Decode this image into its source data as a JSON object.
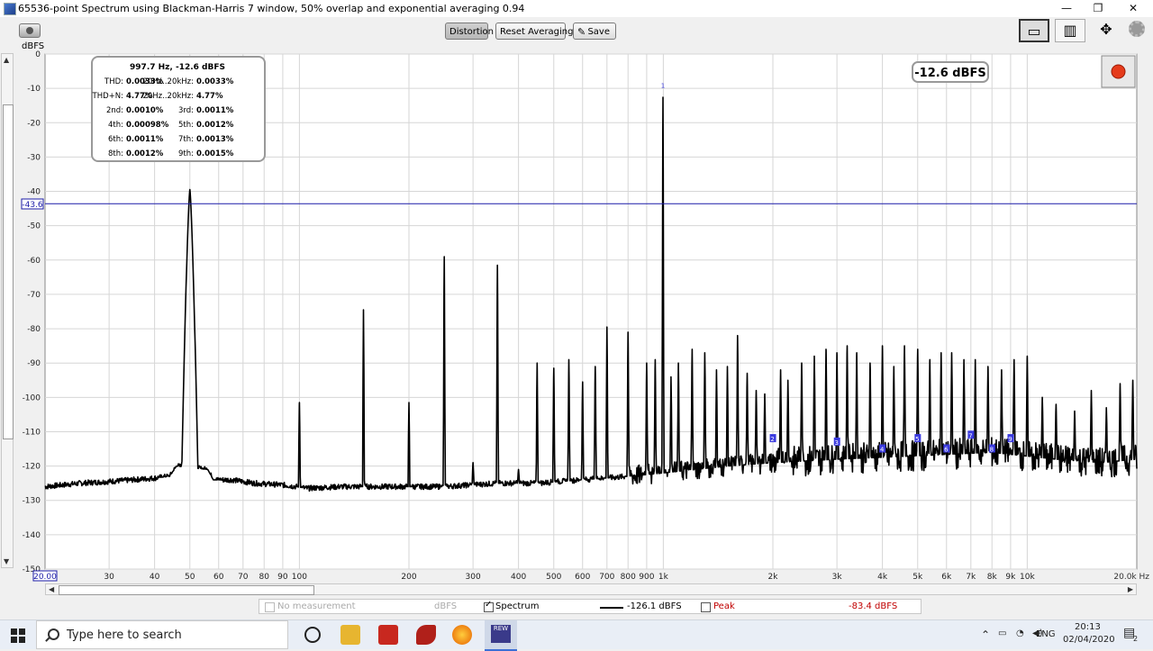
{
  "window": {
    "title": "65536-point Spectrum using Blackman-Harris 7 window, 50% overlap and exponential averaging 0.94",
    "minimize": "—",
    "restore": "❐",
    "close": "✕"
  },
  "toolbar": {
    "distortion_label": "Distortion",
    "reset_label": "Reset Averaging",
    "save_label": "Save",
    "unit_label": "dBFS",
    "icons": [
      "camera-icon",
      "pen-icon",
      "window-view-icon",
      "split-view-icon",
      "move-arrows-icon",
      "gear-icon"
    ]
  },
  "level_badge": "-12.6 dBFS",
  "cursor_level": "-43.6",
  "x_start_label": "20.00",
  "x_end_label": "20.0k Hz",
  "distortion_table": {
    "header": "997.7 Hz, -12.6 dBFS",
    "rows": [
      {
        "l1": "THD:",
        "v1": "0.0033%",
        "l2": "20Hz..20kHz:",
        "v2": "0.0033%"
      },
      {
        "l1": "THD+N:",
        "v1": "4.77%",
        "l2": "20Hz..20kHz:",
        "v2": "4.77%"
      },
      {
        "l1": "2nd:",
        "v1": "0.0010%",
        "l2": "3rd:",
        "v2": "0.0011%"
      },
      {
        "l1": "4th:",
        "v1": "0.00098%",
        "l2": "5th:",
        "v2": "0.0012%"
      },
      {
        "l1": "6th:",
        "v1": "0.0011%",
        "l2": "7th:",
        "v2": "0.0013%"
      },
      {
        "l1": "8th:",
        "v1": "0.0012%",
        "l2": "9th:",
        "v2": "0.0015%"
      }
    ]
  },
  "legend": {
    "no_measurement": "No measurement",
    "no_measurement_unit": "dBFS",
    "spectrum_label": "Spectrum",
    "spectrum_value": "-126.1 dBFS",
    "peak_label": "Peak",
    "peak_value": "-83.4 dBFS"
  },
  "taskbar": {
    "search_placeholder": "Type here to search",
    "lang": "ENG",
    "time": "20:13",
    "date": "02/04/2020",
    "notifications": "2",
    "rew_label": "REW"
  },
  "colors": {
    "trace": "#000000",
    "cursor": "#1c1ca8",
    "grid": "#d6d6d6",
    "peak_text": "#c00000",
    "marker": "#3a3adf"
  },
  "chart_data": {
    "type": "line",
    "xscale": "log",
    "xlim": [
      20,
      20000
    ],
    "ylim": [
      -150,
      0
    ],
    "yticks": [
      0,
      -10,
      -20,
      -30,
      -40,
      -50,
      -60,
      -70,
      -80,
      -90,
      -100,
      -110,
      -120,
      -130,
      -140,
      -150
    ],
    "xticks": [
      {
        "v": 30,
        "label": "30"
      },
      {
        "v": 40,
        "label": "40"
      },
      {
        "v": 50,
        "label": "50"
      },
      {
        "v": 60,
        "label": "60"
      },
      {
        "v": 70,
        "label": "70"
      },
      {
        "v": 80,
        "label": "80"
      },
      {
        "v": 90,
        "label": "90"
      },
      {
        "v": 100,
        "label": "100"
      },
      {
        "v": 200,
        "label": "200"
      },
      {
        "v": 300,
        "label": "300"
      },
      {
        "v": 400,
        "label": "400"
      },
      {
        "v": 500,
        "label": "500"
      },
      {
        "v": 600,
        "label": "600"
      },
      {
        "v": 700,
        "label": "700"
      },
      {
        "v": 800,
        "label": "800"
      },
      {
        "v": 900,
        "label": "900"
      },
      {
        "v": 1000,
        "label": "1k"
      },
      {
        "v": 2000,
        "label": "2k"
      },
      {
        "v": 3000,
        "label": "3k"
      },
      {
        "v": 4000,
        "label": "4k"
      },
      {
        "v": 5000,
        "label": "5k"
      },
      {
        "v": 6000,
        "label": "6k"
      },
      {
        "v": 7000,
        "label": "7k"
      },
      {
        "v": 8000,
        "label": "8k"
      },
      {
        "v": 9000,
        "label": "9k"
      },
      {
        "v": 10000,
        "label": "10k"
      }
    ],
    "cursor_y": -43.6,
    "floor": [
      [
        20,
        -126
      ],
      [
        25,
        -125
      ],
      [
        30,
        -124.5
      ],
      [
        35,
        -124
      ],
      [
        40,
        -123.5
      ],
      [
        44,
        -123
      ],
      [
        46,
        -120
      ],
      [
        56,
        -121
      ],
      [
        58,
        -124
      ],
      [
        65,
        -124
      ],
      [
        75,
        -125
      ],
      [
        90,
        -125.5
      ],
      [
        98,
        -126
      ],
      [
        105,
        -126.5
      ],
      [
        130,
        -126
      ],
      [
        180,
        -126
      ],
      [
        250,
        -126
      ],
      [
        350,
        -125
      ],
      [
        450,
        -125
      ],
      [
        600,
        -124
      ],
      [
        800,
        -123
      ],
      [
        1000,
        -122
      ],
      [
        1500,
        -120
      ],
      [
        2000,
        -119
      ],
      [
        3000,
        -118
      ],
      [
        5000,
        -117
      ],
      [
        8000,
        -116
      ],
      [
        12000,
        -118
      ],
      [
        16000,
        -119
      ],
      [
        20000,
        -118
      ]
    ],
    "peaks": [
      [
        50,
        -39.5
      ],
      [
        100,
        -101.5
      ],
      [
        150,
        -74.5
      ],
      [
        200,
        -101.5
      ],
      [
        250,
        -59
      ],
      [
        300,
        -119
      ],
      [
        350,
        -61.5
      ],
      [
        400,
        -121
      ],
      [
        450,
        -90
      ],
      [
        500,
        -91.5
      ],
      [
        550,
        -89
      ],
      [
        600,
        -95.5
      ],
      [
        650,
        -91
      ],
      [
        700,
        -79.5
      ],
      [
        800,
        -81
      ],
      [
        900,
        -90
      ],
      [
        950,
        -89
      ],
      [
        997.7,
        -12.6
      ],
      [
        1050,
        -94
      ],
      [
        1100,
        -90
      ],
      [
        1200,
        -86
      ],
      [
        1300,
        -87
      ],
      [
        1400,
        -92
      ],
      [
        1500,
        -91
      ],
      [
        1600,
        -82
      ],
      [
        1700,
        -93
      ],
      [
        1800,
        -98
      ],
      [
        1900,
        -99
      ],
      [
        2100,
        -92
      ],
      [
        2200,
        -95
      ],
      [
        2400,
        -90
      ],
      [
        2600,
        -88
      ],
      [
        2800,
        -86
      ],
      [
        3000,
        -87
      ],
      [
        3200,
        -85
      ],
      [
        3400,
        -87
      ],
      [
        3700,
        -90
      ],
      [
        4000,
        -85
      ],
      [
        4300,
        -91
      ],
      [
        4600,
        -85
      ],
      [
        5000,
        -86
      ],
      [
        5400,
        -89
      ],
      [
        5800,
        -87
      ],
      [
        6200,
        -87
      ],
      [
        6700,
        -89
      ],
      [
        7200,
        -89
      ],
      [
        7800,
        -91
      ],
      [
        8500,
        -92
      ],
      [
        9200,
        -89
      ],
      [
        10000,
        -88
      ],
      [
        11000,
        -100
      ],
      [
        12000,
        -102
      ],
      [
        13500,
        -104
      ],
      [
        15000,
        -98
      ],
      [
        16500,
        -103
      ],
      [
        18000,
        -96
      ],
      [
        19500,
        -95
      ]
    ],
    "harmonic_markers": [
      {
        "f": 997.7,
        "db": -9,
        "label": "1"
      },
      {
        "f": 1995,
        "db": -112,
        "label": "2"
      },
      {
        "f": 2993,
        "db": -113,
        "label": "3"
      },
      {
        "f": 3990,
        "db": -115,
        "label": "4"
      },
      {
        "f": 4988,
        "db": -112,
        "label": "5"
      },
      {
        "f": 5986,
        "db": -115,
        "label": "6"
      },
      {
        "f": 6984,
        "db": -111,
        "label": "7"
      },
      {
        "f": 7982,
        "db": -115,
        "label": "8"
      },
      {
        "f": 8979,
        "db": -112,
        "label": "9"
      }
    ]
  }
}
